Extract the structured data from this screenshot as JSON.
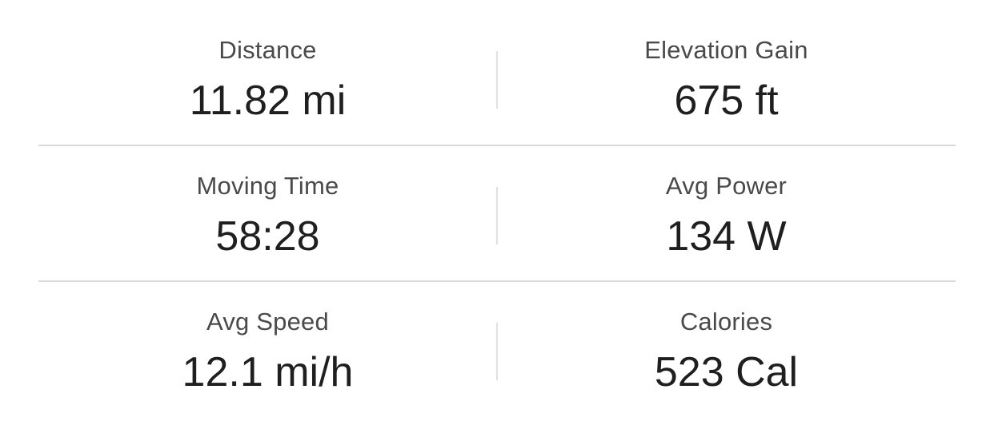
{
  "stats": [
    {
      "left": {
        "label": "Distance",
        "value": "11.82 mi"
      },
      "right": {
        "label": "Elevation Gain",
        "value": "675 ft"
      }
    },
    {
      "left": {
        "label": "Moving Time",
        "value": "58:28"
      },
      "right": {
        "label": "Avg Power",
        "value": "134 W"
      }
    },
    {
      "left": {
        "label": "Avg Speed",
        "value": "12.1 mi/h"
      },
      "right": {
        "label": "Calories",
        "value": "523 Cal"
      }
    }
  ]
}
